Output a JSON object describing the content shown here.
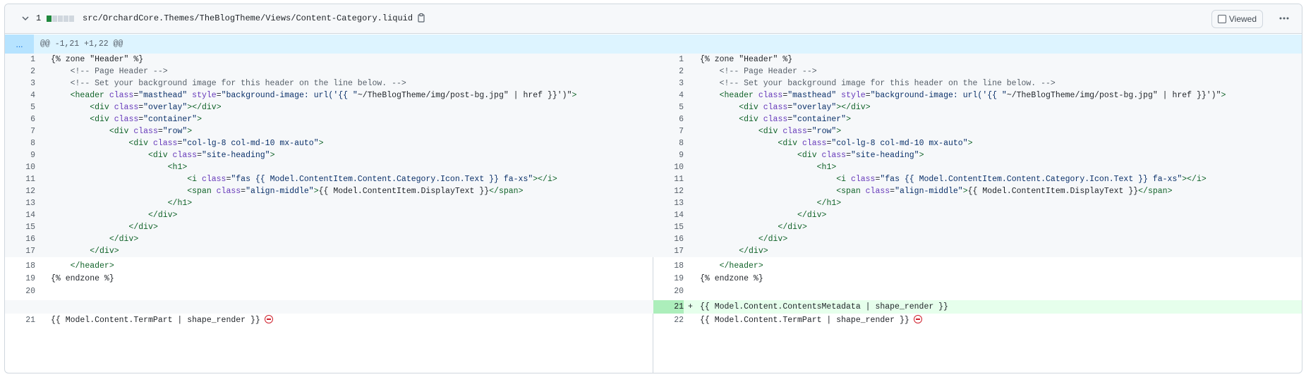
{
  "header": {
    "changed_count": "1",
    "file_path": "src/OrchardCore.Themes/TheBlogTheme/Views/Content-Category.liquid",
    "viewed_label": "Viewed",
    "diffstat_colors": [
      "#1f883d",
      "#d0d7de",
      "#d0d7de",
      "#d0d7de",
      "#d0d7de"
    ]
  },
  "hunk": {
    "expand_label": "...",
    "header": "@@ -1,21 +1,22 @@"
  },
  "lines": [
    {
      "l": "1",
      "r": "1",
      "code": "{% zone \"Header\" %}"
    },
    {
      "l": "2",
      "r": "2",
      "code": "    <!-- Page Header -->"
    },
    {
      "l": "3",
      "r": "3",
      "code": "    <!-- Set your background image for this header on the line below. -->"
    },
    {
      "l": "4",
      "r": "4",
      "code": "    <header class=\"masthead\" style=\"background-image: url('{{ \"~/TheBlogTheme/img/post-bg.jpg\" | href }}')\">"
    },
    {
      "l": "5",
      "r": "5",
      "code": "        <div class=\"overlay\"></div>"
    },
    {
      "l": "6",
      "r": "6",
      "code": "        <div class=\"container\">"
    },
    {
      "l": "7",
      "r": "7",
      "code": "            <div class=\"row\">"
    },
    {
      "l": "8",
      "r": "8",
      "code": "                <div class=\"col-lg-8 col-md-10 mx-auto\">"
    },
    {
      "l": "9",
      "r": "9",
      "code": "                    <div class=\"site-heading\">"
    },
    {
      "l": "10",
      "r": "10",
      "code": "                        <h1>"
    },
    {
      "l": "11",
      "r": "11",
      "code": "                            <i class=\"fas {{ Model.ContentItem.Content.Category.Icon.Text }} fa-xs\"></i>"
    },
    {
      "l": "12",
      "r": "12",
      "code": "                            <span class=\"align-middle\">{{ Model.ContentItem.DisplayText }}</span>"
    },
    {
      "l": "13",
      "r": "13",
      "code": "                        </h1>"
    },
    {
      "l": "14",
      "r": "14",
      "code": "                    </div>"
    },
    {
      "l": "15",
      "r": "15",
      "code": "                </div>"
    },
    {
      "l": "16",
      "r": "16",
      "code": "            </div>"
    },
    {
      "l": "17",
      "r": "17",
      "code": "        </div>"
    },
    {
      "l": "18",
      "r": "18",
      "code": "    </header>"
    },
    {
      "l": "19",
      "r": "19",
      "code": "{% endzone %}"
    },
    {
      "l": "20",
      "r": "20",
      "code": ""
    }
  ],
  "added_line": {
    "r": "21",
    "marker": "+",
    "code": "{{ Model.Content.ContentsMetadata | shape_render }}"
  },
  "last_line": {
    "l": "21",
    "r": "22",
    "code": "{{ Model.Content.TermPart | shape_render }}"
  },
  "icons": {
    "chevron": "chevron-down-icon",
    "copy": "copy-icon",
    "kebab": "kebab-horizontal-icon",
    "no_newline": "no-newline-icon"
  }
}
